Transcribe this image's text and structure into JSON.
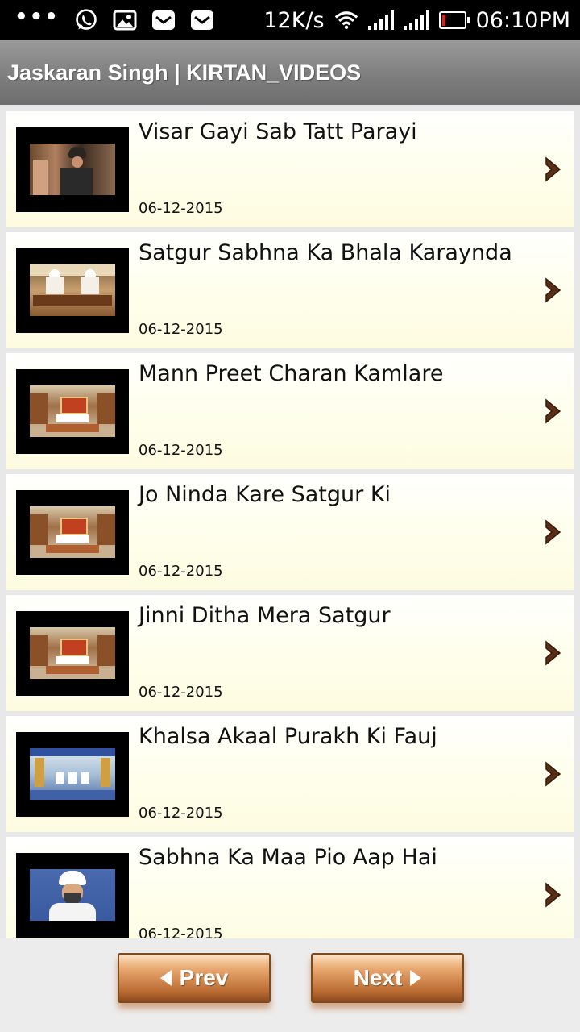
{
  "status_bar": {
    "speed": "12K/s",
    "time": "06:10PM"
  },
  "header": {
    "title": "Jaskaran Singh | KIRTAN_VIDEOS"
  },
  "videos": [
    {
      "title": "Visar Gayi Sab Tatt Parayi",
      "date": "06-12-2015"
    },
    {
      "title": "Satgur Sabhna Ka Bhala Karaynda",
      "date": "06-12-2015"
    },
    {
      "title": "Mann Preet Charan Kamlare",
      "date": "06-12-2015"
    },
    {
      "title": "Jo Ninda Kare Satgur Ki",
      "date": "06-12-2015"
    },
    {
      "title": "Jinni Ditha Mera Satgur",
      "date": "06-12-2015"
    },
    {
      "title": "Khalsa Akaal Purakh Ki Fauj",
      "date": "06-12-2015"
    },
    {
      "title": "Sabhna Ka Maa Pio Aap Hai",
      "date": "06-12-2015"
    }
  ],
  "pagination": {
    "prev_label": "Prev",
    "next_label": "Next"
  }
}
